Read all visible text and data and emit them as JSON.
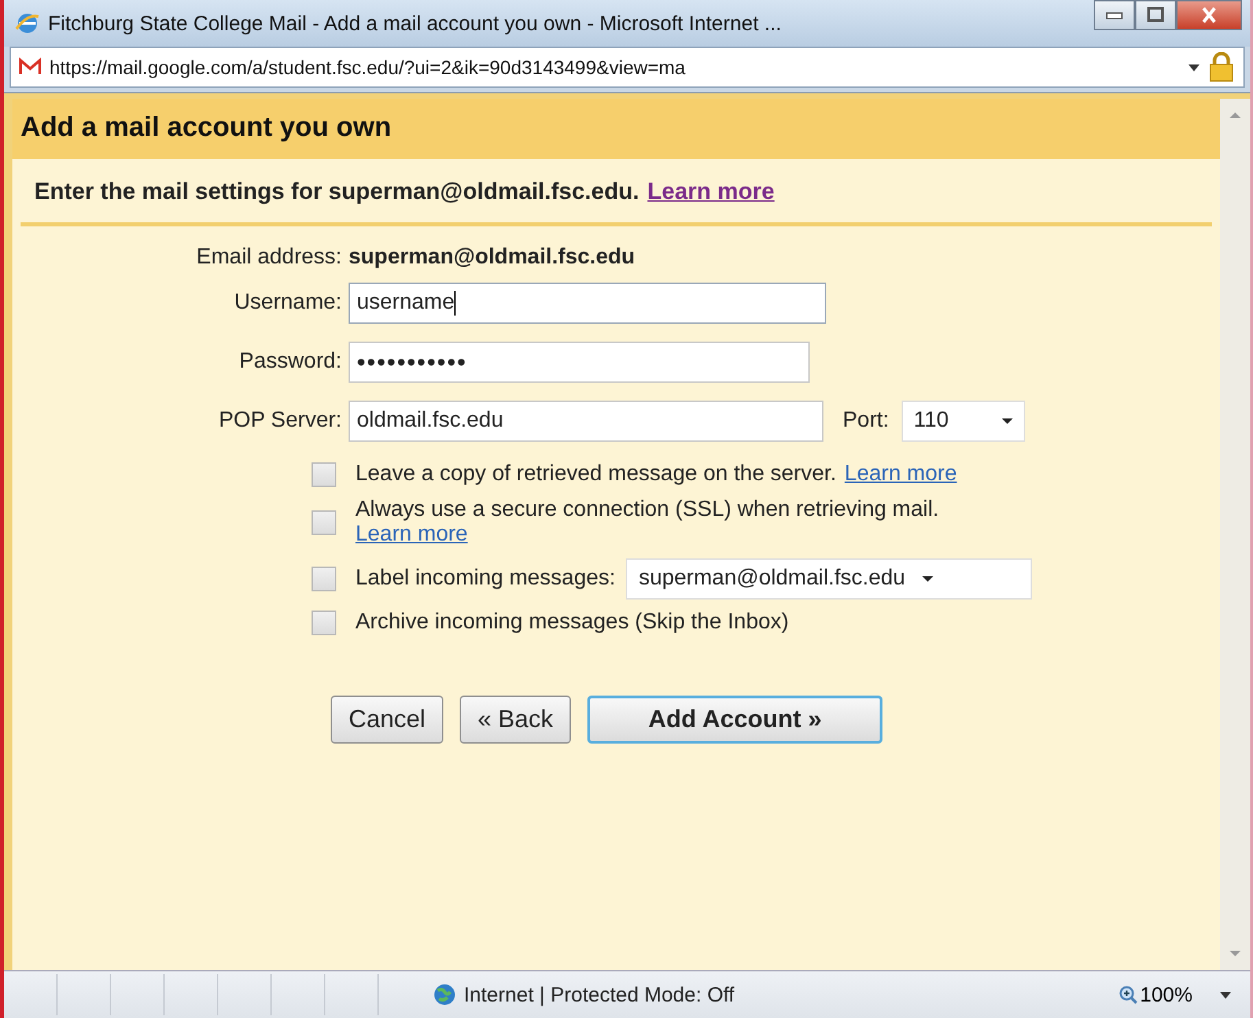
{
  "window": {
    "title": "Fitchburg State College Mail - Add a mail account you own - Microsoft Internet ..."
  },
  "address_bar": {
    "url": "https://mail.google.com/a/student.fsc.edu/?ui=2&ik=90d3143499&view=ma"
  },
  "dialog": {
    "title": "Add a mail account you own",
    "intro": "Enter the mail settings for superman@oldmail.fsc.edu.",
    "intro_link": "Learn more",
    "email": {
      "label": "Email address:",
      "value": "superman@oldmail.fsc.edu"
    },
    "fields": [
      {
        "label": "Username:",
        "value": "username",
        "focused": true
      },
      {
        "label": "Password:",
        "value": "•••••••••••",
        "focused": false
      },
      {
        "label": "POP Server:",
        "value": "oldmail.fsc.edu",
        "focused": false
      }
    ],
    "port": {
      "label": "Port:",
      "value": "110"
    },
    "options": [
      {
        "kind": "link",
        "label": "Leave a copy of retrieved message on the server.",
        "link": "Learn more",
        "checked": false
      },
      {
        "kind": "wraplink",
        "label": "Always use a secure connection (SSL) when retrieving mail.",
        "link": "Learn more",
        "checked": false
      },
      {
        "kind": "select",
        "label": "Label incoming messages:",
        "value": "superman@oldmail.fsc.edu",
        "checked": false
      },
      {
        "kind": "plain",
        "label": "Archive incoming messages (Skip the Inbox)",
        "checked": false
      }
    ],
    "buttons": [
      {
        "label": "Cancel",
        "primary": false
      },
      {
        "label": "« Back",
        "primary": false
      },
      {
        "label": "Add Account »",
        "primary": true
      }
    ]
  },
  "status_bar": {
    "zone": "Internet | Protected Mode: Off",
    "zoom": "100%"
  }
}
